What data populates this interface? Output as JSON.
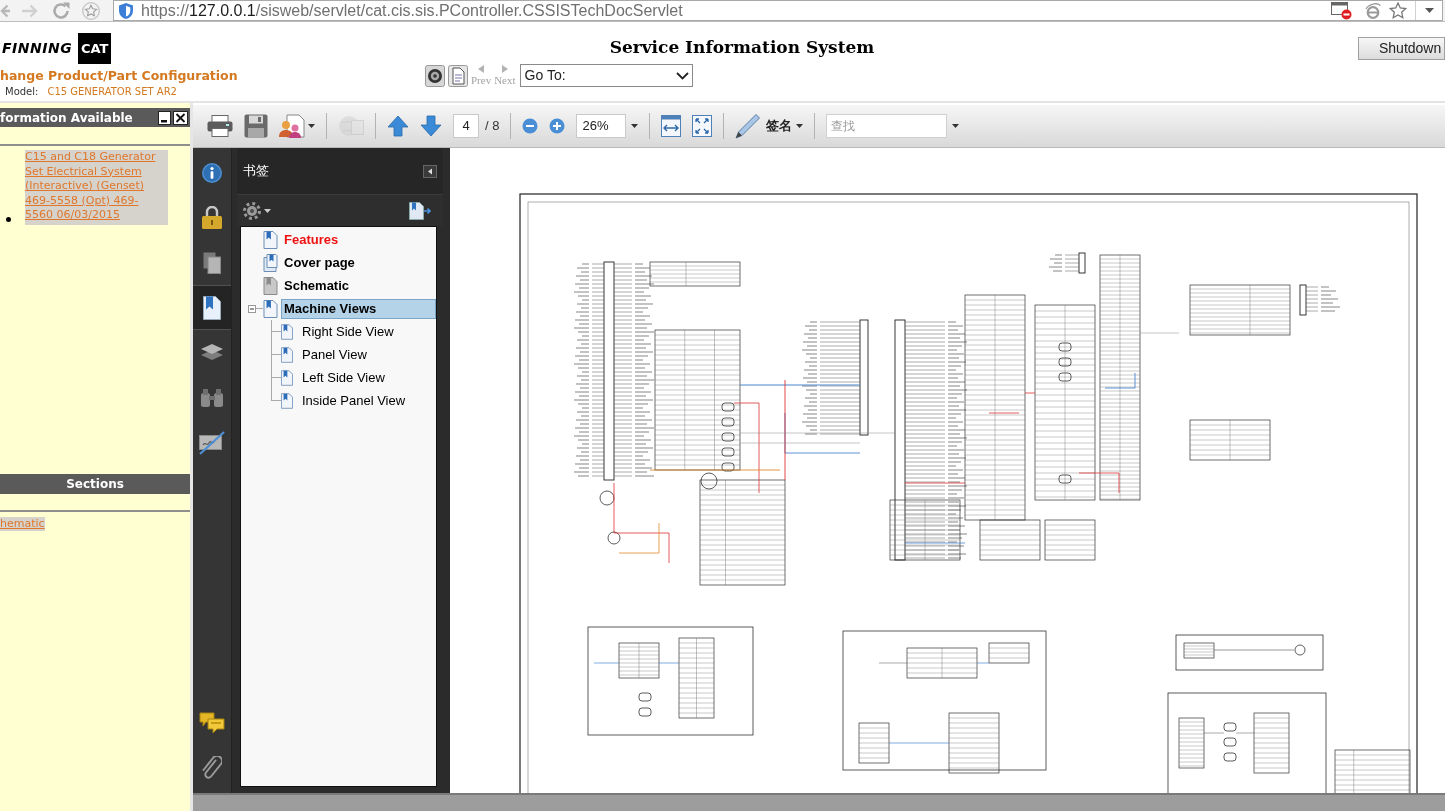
{
  "browser": {
    "url": {
      "scheme": "https://",
      "host": "127.0.0.1",
      "path": "/sisweb/servlet/cat.cis.sis.PController.CSSISTechDocServlet"
    }
  },
  "header": {
    "logo": {
      "wordmark": "FINNING",
      "badge": "CAT"
    },
    "title": "Service Information System",
    "shutdown_button": "Shutdown",
    "page_heading": "hange Product/Part Configuration",
    "model": {
      "label": "Model:",
      "value": "C15 GENERATOR SET AR2"
    },
    "nav_links": [
      {
        "label": "Prev",
        "disabled": true
      },
      {
        "label": "Next",
        "disabled": true
      }
    ],
    "goto_select": {
      "value": "Go To:"
    }
  },
  "info_panel": {
    "title": "formation Available",
    "documents": [
      "C15 and C18 Generator Set Electrical System (Interactive) (Genset) 469-5558 (Opt) 469-5560 06/03/2015"
    ],
    "sections_title": "Sections",
    "sections": [
      "hematic"
    ]
  },
  "pdf_viewer": {
    "toolbar": {
      "groups": [
        {
          "items": [
            {
              "kind": "print",
              "disabled": false
            },
            {
              "kind": "save",
              "disabled": false
            },
            {
              "kind": "share",
              "disabled": false
            }
          ]
        },
        {
          "items": [
            {
              "kind": "web",
              "disabled": true
            }
          ]
        },
        {
          "items": [
            {
              "kind": "up",
              "disabled": false
            },
            {
              "kind": "down",
              "disabled": false
            },
            {
              "kind": "pagenumber",
              "value": "4",
              "total": "/ 8"
            }
          ]
        },
        {
          "items": [
            {
              "kind": "zoomout",
              "disabled": false
            },
            {
              "kind": "zoomin",
              "disabled": false
            },
            {
              "kind": "zoom",
              "value": "26%"
            }
          ]
        },
        {
          "items": [
            {
              "kind": "fitwidth",
              "disabled": false
            },
            {
              "kind": "fitpage",
              "disabled": false
            }
          ]
        },
        {
          "items": [
            {
              "kind": "sign",
              "label": "签名"
            }
          ]
        },
        {
          "items": [
            {
              "kind": "find",
              "placeholder": "查找"
            }
          ]
        }
      ]
    },
    "side_tabs": {
      "top": [
        {
          "kind": "info",
          "selected": false
        },
        {
          "kind": "security",
          "selected": false
        },
        {
          "kind": "pages",
          "selected": false
        },
        {
          "kind": "bookmarks",
          "selected": true
        },
        {
          "kind": "layers",
          "selected": false
        },
        {
          "kind": "search",
          "selected": false
        },
        {
          "kind": "signatures",
          "selected": false
        }
      ],
      "bottom": [
        {
          "kind": "comments",
          "selected": false
        },
        {
          "kind": "attachments",
          "selected": false
        }
      ]
    },
    "bookmarks": {
      "title": "书签",
      "items": [
        {
          "label": "Features",
          "kind": "page",
          "color": "#ee1111",
          "selected": false
        },
        {
          "label": "Cover page",
          "kind": "pages",
          "color": "#000000",
          "selected": false
        },
        {
          "label": "Schematic",
          "kind": "blank",
          "color": "#000000",
          "selected": false
        },
        {
          "label": "Machine Views",
          "kind": "page",
          "color": "#000000",
          "selected": true,
          "expanded": true,
          "children": [
            {
              "label": "Right Side View",
              "kind": "page",
              "color": "#000000",
              "selected": false
            },
            {
              "label": "Panel View",
              "kind": "page",
              "color": "#000000",
              "selected": false
            },
            {
              "label": "Left Side View",
              "kind": "page",
              "color": "#000000",
              "selected": false
            },
            {
              "label": "Inside Panel View",
              "kind": "page",
              "color": "#000000",
              "selected": false
            }
          ]
        }
      ]
    }
  }
}
